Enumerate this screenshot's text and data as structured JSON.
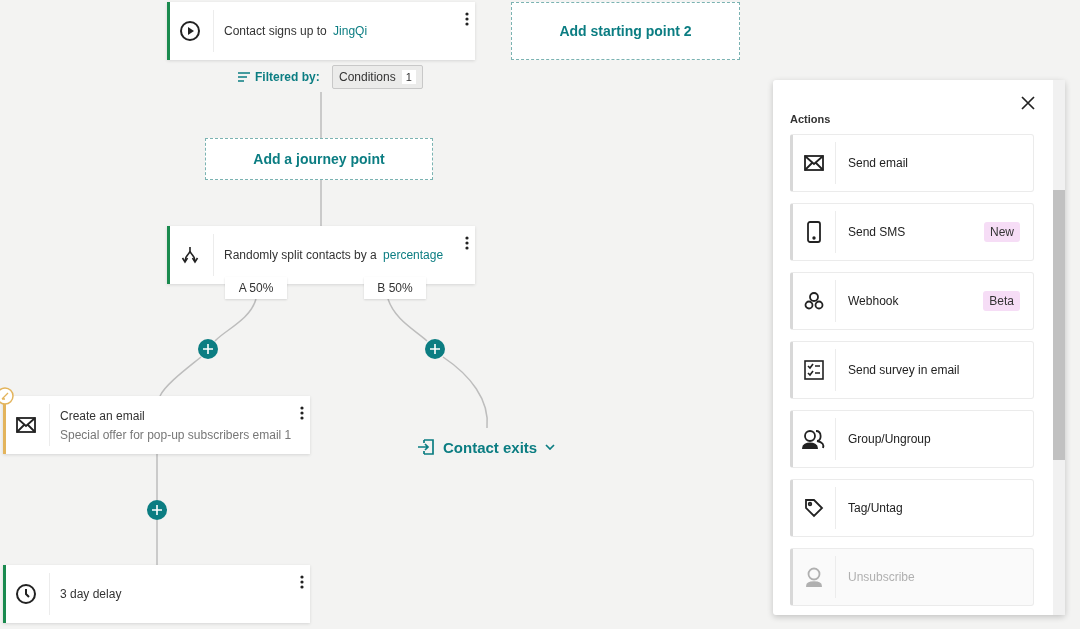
{
  "canvas": {
    "start_node": {
      "text": "Contact signs up to",
      "link": "JingQi",
      "color": "#1a8a4f"
    },
    "add_start": {
      "label": "Add starting point 2"
    },
    "filter": {
      "label": "Filtered by:",
      "chip": "Conditions",
      "count": "1"
    },
    "add_point": {
      "label": "Add a journey point"
    },
    "split_node": {
      "text": "Randomly split contacts by a",
      "link": "percentage",
      "color": "#1a8a4f",
      "branches": [
        "A 50%",
        "B 50%"
      ]
    },
    "email_node": {
      "title": "Create an email",
      "subtitle": "Special offer for pop-up subscribers email 1",
      "color": "#e3b45c",
      "edit_badge": true
    },
    "delay_node": {
      "title": "3 day delay",
      "color": "#1a8a4f"
    },
    "exit": {
      "label": "Contact exits"
    }
  },
  "panel": {
    "heading": "Actions",
    "items": [
      {
        "kind": "email",
        "label": "Send email",
        "disabled": false
      },
      {
        "kind": "sms",
        "label": "Send SMS",
        "badge": "New",
        "disabled": false
      },
      {
        "kind": "webhook",
        "label": "Webhook",
        "badge": "Beta",
        "disabled": false
      },
      {
        "kind": "survey",
        "label": "Send survey in email",
        "disabled": false
      },
      {
        "kind": "group",
        "label": "Group/Ungroup",
        "disabled": false
      },
      {
        "kind": "tag",
        "label": "Tag/Untag",
        "disabled": false
      },
      {
        "kind": "unsubscribe",
        "label": "Unsubscribe",
        "disabled": true
      }
    ]
  }
}
